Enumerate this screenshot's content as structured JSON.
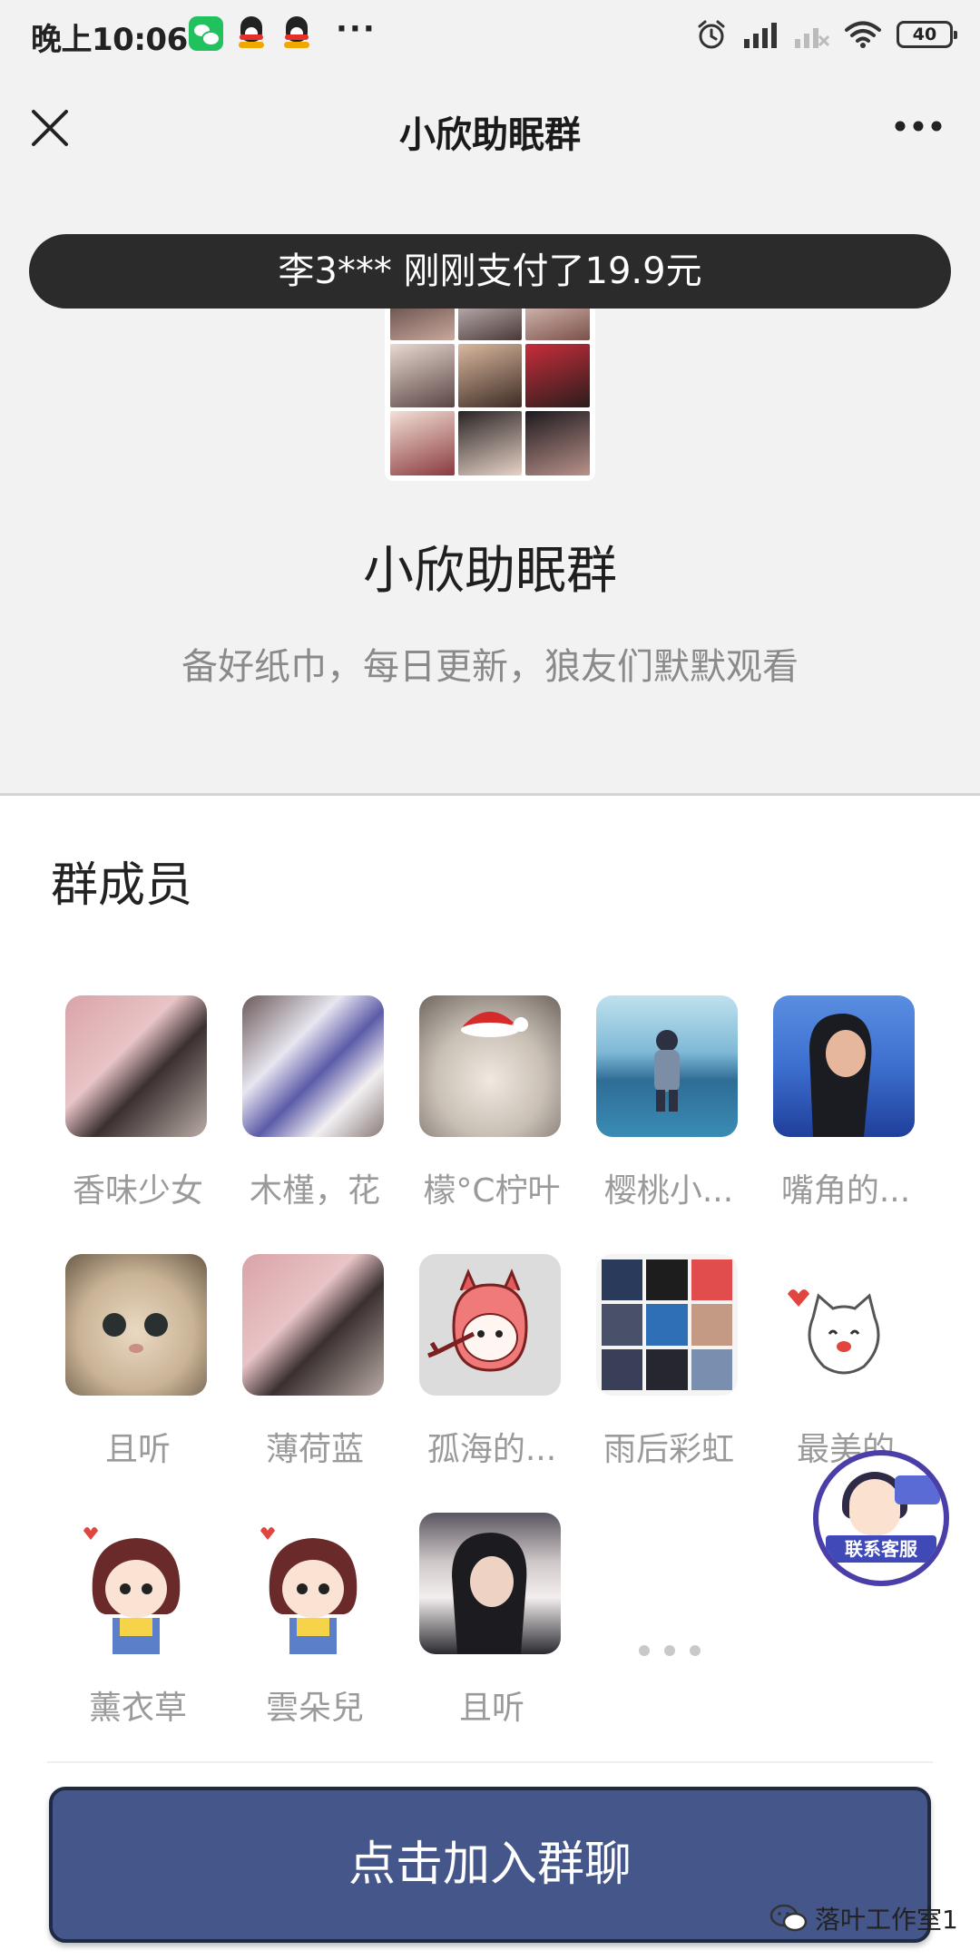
{
  "status_bar": {
    "time": "晚上10:06",
    "more": "···",
    "battery": "40"
  },
  "navbar": {
    "title": "小欣助眠群"
  },
  "toast": {
    "text": "李3*** 刚刚支付了19.9元"
  },
  "group": {
    "name": "小欣助眠群",
    "description": "备好纸巾，每日更新，狼友们默默观看"
  },
  "members_section": {
    "heading": "群成员",
    "members": [
      {
        "name": "香味少女",
        "avatar": "girl-photo-pink-wall"
      },
      {
        "name": "木槿，花",
        "avatar": "cat-photo"
      },
      {
        "name": "檬°C柠叶",
        "avatar": "cat-santa-hat"
      },
      {
        "name": "樱桃小...",
        "avatar": "boy-lake-illustration"
      },
      {
        "name": "嘴角的...",
        "avatar": "girl-photo-blue"
      },
      {
        "name": "且听",
        "avatar": "cat-closeup"
      },
      {
        "name": "薄荷蓝",
        "avatar": "girl-photo-pink-wall"
      },
      {
        "name": "孤海的...",
        "avatar": "cartoon-devil"
      },
      {
        "name": "雨后彩虹",
        "avatar": "photo-grid"
      },
      {
        "name": "最美的",
        "avatar": "cartoon-cat"
      },
      {
        "name": "薰衣草",
        "avatar": "cartoon-girl"
      },
      {
        "name": "雲朵兒",
        "avatar": "cartoon-girl"
      },
      {
        "name": "且听",
        "avatar": "girl-photo-peace"
      }
    ]
  },
  "join_button": {
    "label": "点击加入群聊"
  },
  "customer_service": {
    "label": "联系客服"
  },
  "watermark": {
    "text": "落叶工作室1"
  },
  "colors": {
    "join_button": "#45578a",
    "toast": "#2b2b2b",
    "page_bg": "#f2f2f2"
  }
}
